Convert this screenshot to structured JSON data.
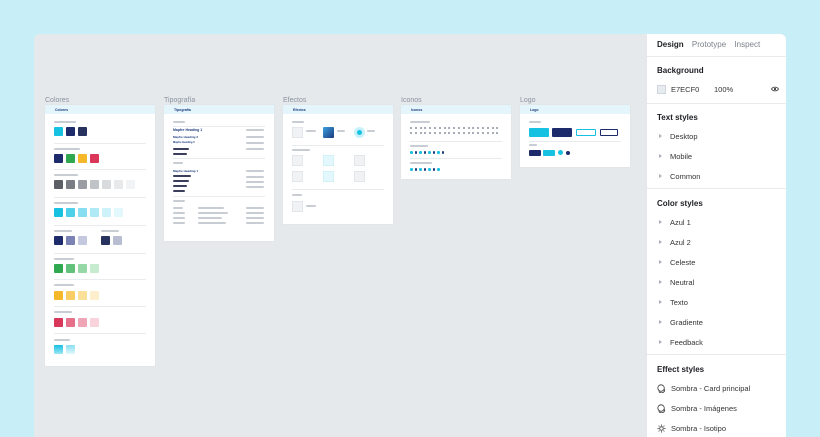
{
  "canvas": {
    "frames": {
      "colores": {
        "label": "Colores",
        "header": "Colores"
      },
      "tipografia": {
        "label": "Tipografía",
        "header": "Tipografía"
      },
      "efectos": {
        "label": "Efectos",
        "header": "Efectos"
      },
      "iconos": {
        "label": "Iconos",
        "header": "Iconos"
      },
      "logo": {
        "label": "Logo",
        "header": "Logo"
      }
    },
    "tipografia_samples": [
      "Mapfre Heading 1",
      "Mapfre Heading 2",
      "Mapfre Heading 3"
    ]
  },
  "panel": {
    "tabs": {
      "design": "Design",
      "prototype": "Prototype",
      "inspect": "Inspect"
    },
    "background": {
      "title": "Background",
      "hex": "E7ECF0",
      "opacity": "100%",
      "swatch_color": "#e7ecf0"
    },
    "text_styles": {
      "title": "Text styles",
      "items": [
        "Desktop",
        "Mobile",
        "Common"
      ]
    },
    "color_styles": {
      "title": "Color styles",
      "items": [
        "Azul 1",
        "Azul 2",
        "Celeste",
        "Neutral",
        "Texto",
        "Gradiente",
        "Feedback"
      ]
    },
    "effect_styles": {
      "title": "Effect styles",
      "items": [
        "Sombra - Card principal",
        "Sombra - Imágenes",
        "Sombra - Isotipo"
      ]
    }
  },
  "colors": {
    "page_bg": "#c8eff7",
    "canvas_bg": "#e6e9ec",
    "brand_blue": "#1c3b7d",
    "cyan": "#17c1e2"
  }
}
